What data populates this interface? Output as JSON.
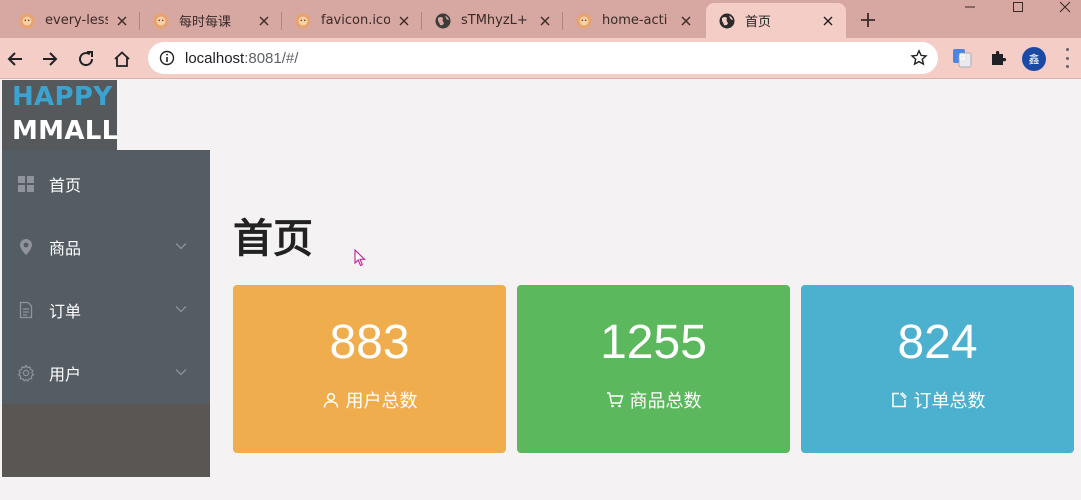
{
  "browser": {
    "tabs": [
      {
        "title": "every-less",
        "icon": "lion-icon"
      },
      {
        "title": "每时每课",
        "icon": "lion-icon"
      },
      {
        "title": "favicon.ico",
        "icon": "lion-icon"
      },
      {
        "title": "sTMhyzL+",
        "icon": "globe-icon"
      },
      {
        "title": "home-acti",
        "icon": "lion-icon"
      },
      {
        "title": "首页",
        "icon": "globe-icon",
        "active": true
      }
    ],
    "address": {
      "host": "localhost",
      "rest": ":8081/#/"
    },
    "profile_initial": "鑫",
    "colors": {
      "tabstrip": "#d7a7a1",
      "toolbar": "#f3cdc6"
    }
  },
  "app": {
    "logo": {
      "line1": "HAPPY",
      "line2": "MMALL"
    },
    "menu": [
      {
        "label": "首页",
        "icon": "grid-icon",
        "expandable": false
      },
      {
        "label": "商品",
        "icon": "location-pin-icon",
        "expandable": true
      },
      {
        "label": "订单",
        "icon": "document-icon",
        "expandable": true
      },
      {
        "label": "用户",
        "icon": "gear-icon",
        "expandable": true
      }
    ],
    "page_title": "首页",
    "stats": [
      {
        "value": "883",
        "label": "用户总数",
        "icon": "user-icon",
        "color": "#f0ad4e"
      },
      {
        "value": "1255",
        "label": "商品总数",
        "icon": "cart-icon",
        "color": "#5cb85c"
      },
      {
        "value": "824",
        "label": "订单总数",
        "icon": "edit-icon",
        "color": "#4cb0cf"
      }
    ]
  }
}
